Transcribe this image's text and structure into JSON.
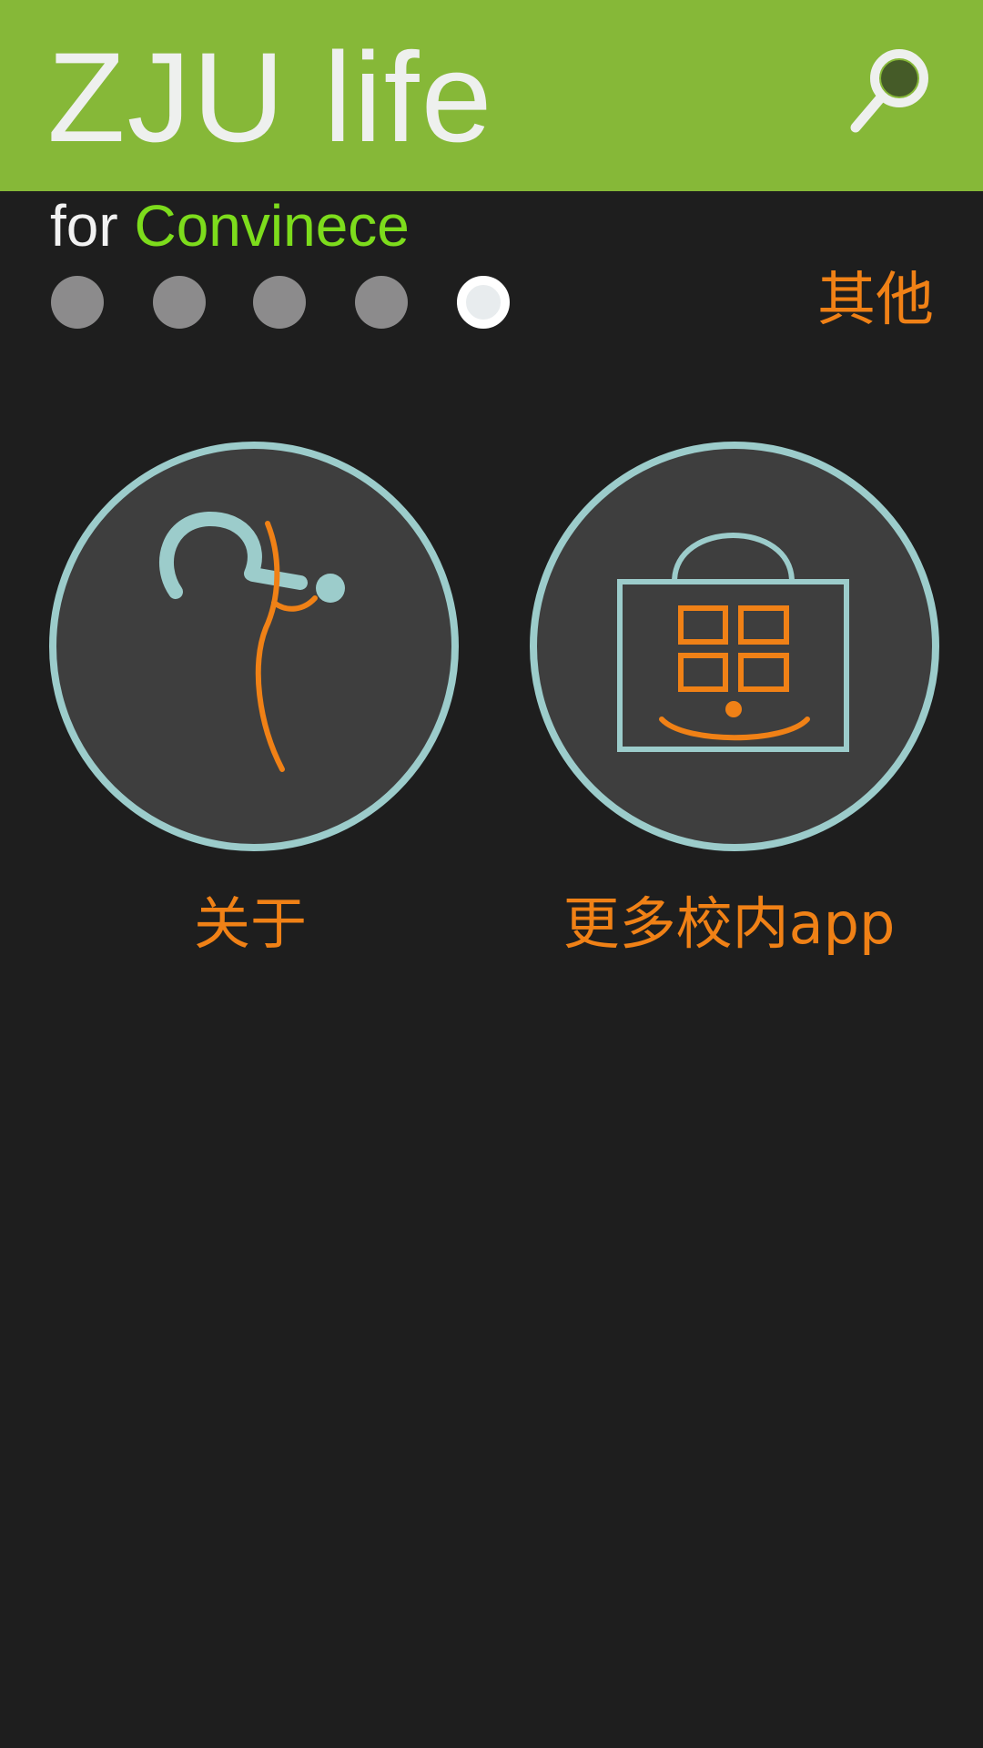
{
  "header": {
    "title": "ZJU life",
    "search_icon": "search-icon",
    "background_color": "#86b838"
  },
  "subtitle": {
    "prefix": "for ",
    "accent": "Convinece",
    "accent_color": "#7ddc1c"
  },
  "pager": {
    "count": 5,
    "active_index": 4
  },
  "section": {
    "label": "其他"
  },
  "tiles": [
    {
      "label": "关于",
      "icon": "about-icon"
    },
    {
      "label": "更多校内app",
      "icon": "app-store-bag-icon"
    }
  ],
  "colors": {
    "accent_orange": "#f08116",
    "circle_stroke": "#9ccccb",
    "circle_fill": "#3e3e3e",
    "background": "#1e1e1e"
  }
}
